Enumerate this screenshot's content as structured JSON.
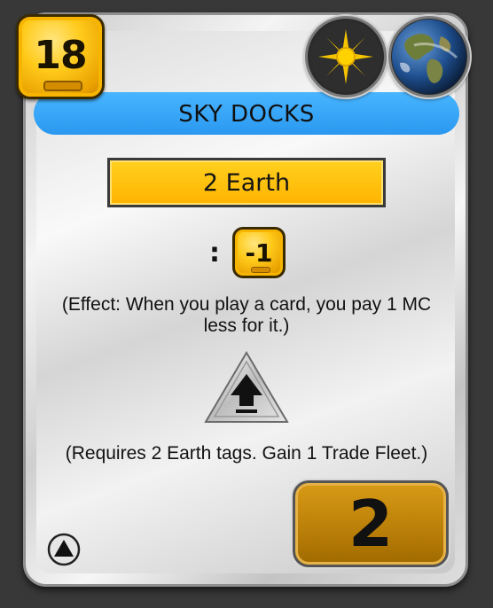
{
  "card": {
    "cost": "18",
    "title": "SKY DOCKS",
    "requirement": "2 Earth",
    "effect_separator": ":",
    "effect_modifier": "-1",
    "effect_text": "(Effect: When you play a card, you pay 1 MC less for it.)",
    "requirement_text": "(Requires 2 Earth tags. Gain 1 Trade Fleet.)",
    "victory_points": "2",
    "tags": [
      {
        "icon": "space-tag-icon"
      },
      {
        "icon": "earth-tag-icon"
      }
    ],
    "colors": {
      "title_bar": "#2a98f0",
      "cost_badge": "#ffca1a",
      "requirement_box": "#ffc20a",
      "vp_box": "#b97e08"
    }
  }
}
